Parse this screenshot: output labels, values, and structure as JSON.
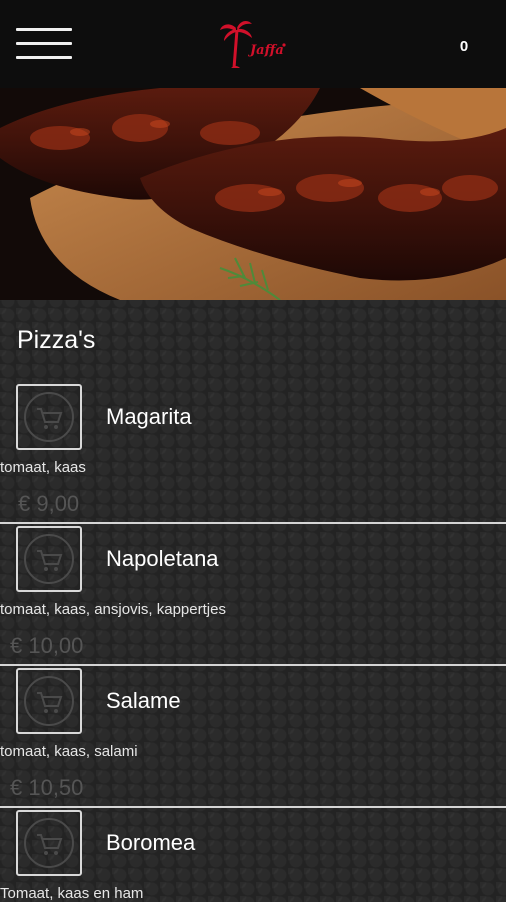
{
  "header": {
    "menu_icon": "hamburger-menu-icon",
    "logo_text": "Jaffa",
    "brand_color": "#d1102a",
    "cart_count": "0"
  },
  "hero": {
    "image": "grilled-ribs-photo"
  },
  "section": {
    "title": "Pizza's"
  },
  "items": [
    {
      "name": "Magarita",
      "description": "tomaat, kaas",
      "price": "€ 9,00",
      "icon": "cart-icon"
    },
    {
      "name": "Napoletana",
      "description": "tomaat, kaas, ansjovis, kappertjes",
      "price": "€ 10,00",
      "icon": "cart-icon"
    },
    {
      "name": "Salame",
      "description": "tomaat, kaas, salami",
      "price": "€ 10,50",
      "icon": "cart-icon"
    },
    {
      "name": "Boromea",
      "description": "Tomaat, kaas en ham",
      "price": "",
      "icon": "cart-icon"
    }
  ]
}
